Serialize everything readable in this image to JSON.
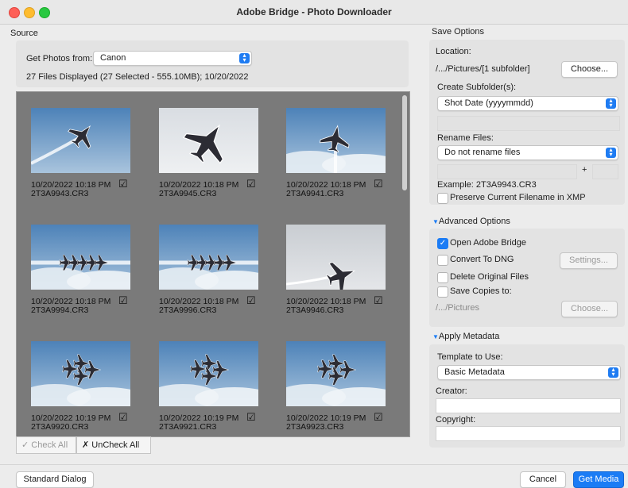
{
  "window": {
    "title": "Adobe Bridge - Photo Downloader"
  },
  "source": {
    "section_label": "Source",
    "get_photos_label": "Get Photos from:",
    "get_photos_value": "Canon",
    "status": "27 Files Displayed (27 Selected - 555.10MB); 10/20/2022"
  },
  "photos": [
    {
      "date": "10/20/2022 10:18 PM",
      "file": "2T3A9943.CR3",
      "checked": true,
      "icon": "jet-single-climb"
    },
    {
      "date": "10/20/2022 10:18 PM",
      "file": "2T3A9945.CR3",
      "checked": true,
      "icon": "jet-single-close"
    },
    {
      "date": "10/20/2022 10:18 PM",
      "file": "2T3A9941.CR3",
      "checked": true,
      "icon": "jet-single-vertical"
    },
    {
      "date": "10/20/2022 10:18 PM",
      "file": "2T3A9994.CR3",
      "checked": true,
      "icon": "jet-formation-line"
    },
    {
      "date": "10/20/2022 10:18 PM",
      "file": "2T3A9996.CR3",
      "checked": true,
      "icon": "jet-formation-line"
    },
    {
      "date": "10/20/2022 10:18 PM",
      "file": "2T3A9946.CR3",
      "checked": true,
      "icon": "jet-single-low"
    },
    {
      "date": "10/20/2022 10:19 PM",
      "file": "2T3A9920.CR3",
      "checked": true,
      "icon": "jet-formation-diamond"
    },
    {
      "date": "10/20/2022 10:19 PM",
      "file": "2T3A9921.CR3",
      "checked": true,
      "icon": "jet-formation-diamond"
    },
    {
      "date": "10/20/2022 10:19 PM",
      "file": "2T3A9923.CR3",
      "checked": true,
      "icon": "jet-formation-diamond"
    }
  ],
  "grid_buttons": {
    "check_all": "Check All",
    "uncheck_all": "UnCheck All"
  },
  "save_options": {
    "section_label": "Save Options",
    "location_label": "Location:",
    "location_value": "/.../Pictures/[1 subfolder]",
    "choose_label": "Choose...",
    "subfolder_label": "Create Subfolder(s):",
    "subfolder_value": "Shot Date (yyyymmdd)",
    "rename_label": "Rename Files:",
    "rename_value": "Do not rename files",
    "plus": "+",
    "example": "Example:  2T3A9943.CR3",
    "preserve_label": "Preserve Current Filename in XMP"
  },
  "advanced": {
    "section_label": "Advanced Options",
    "open_bridge": "Open Adobe Bridge",
    "convert_dng": "Convert To DNG",
    "settings": "Settings...",
    "delete_originals": "Delete Original Files",
    "save_copies": "Save Copies to:",
    "copies_path": "/.../Pictures",
    "choose_label": "Choose..."
  },
  "metadata": {
    "section_label": "Apply Metadata",
    "template_label": "Template to Use:",
    "template_value": "Basic Metadata",
    "creator_label": "Creator:",
    "creator_value": "",
    "copyright_label": "Copyright:",
    "copyright_value": ""
  },
  "footer": {
    "standard_dialog": "Standard Dialog",
    "cancel": "Cancel",
    "get_media": "Get Media"
  },
  "colors": {
    "accent": "#1b7cf5",
    "grid_bg": "#7a7a7a"
  }
}
